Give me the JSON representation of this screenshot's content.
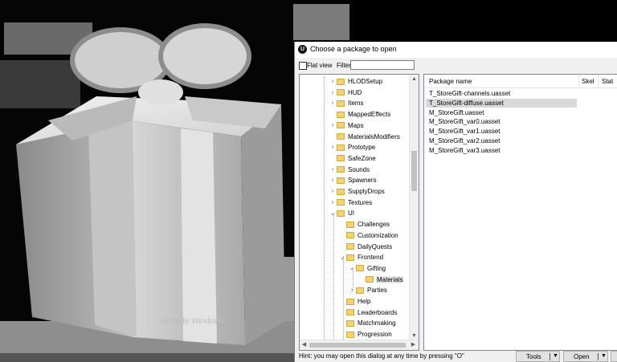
{
  "dialog": {
    "title": "Choose a package to open",
    "flat_view_label": "Flat view",
    "filter_label": "Filter:",
    "filter_value": ""
  },
  "tree": {
    "items": [
      {
        "label": "HLODSetup",
        "level": 0,
        "expandable": true,
        "expanded": false
      },
      {
        "label": "HUD",
        "level": 0,
        "expandable": true,
        "expanded": false
      },
      {
        "label": "Items",
        "level": 0,
        "expandable": true,
        "expanded": false
      },
      {
        "label": "MappedEffects",
        "level": 0,
        "expandable": false,
        "expanded": false
      },
      {
        "label": "Maps",
        "level": 0,
        "expandable": true,
        "expanded": false
      },
      {
        "label": "MaterialsModifiers",
        "level": 0,
        "expandable": false,
        "expanded": false
      },
      {
        "label": "Prototype",
        "level": 0,
        "expandable": true,
        "expanded": false
      },
      {
        "label": "SafeZone",
        "level": 0,
        "expandable": false,
        "expanded": false
      },
      {
        "label": "Sounds",
        "level": 0,
        "expandable": true,
        "expanded": false
      },
      {
        "label": "Spawners",
        "level": 0,
        "expandable": true,
        "expanded": false
      },
      {
        "label": "SupplyDrops",
        "level": 0,
        "expandable": true,
        "expanded": false
      },
      {
        "label": "Textures",
        "level": 0,
        "expandable": true,
        "expanded": false
      },
      {
        "label": "UI",
        "level": 0,
        "expandable": true,
        "expanded": true
      },
      {
        "label": "Challenges",
        "level": 1,
        "expandable": false,
        "expanded": false
      },
      {
        "label": "Customization",
        "level": 1,
        "expandable": false,
        "expanded": false
      },
      {
        "label": "DailyQuests",
        "level": 1,
        "expandable": false,
        "expanded": false
      },
      {
        "label": "Frontend",
        "level": 1,
        "expandable": true,
        "expanded": true
      },
      {
        "label": "Gifting",
        "level": 2,
        "expandable": true,
        "expanded": true
      },
      {
        "label": "Materials",
        "level": 3,
        "expandable": false,
        "expanded": false,
        "selected": true
      },
      {
        "label": "Parties",
        "level": 2,
        "expandable": true,
        "expanded": false
      },
      {
        "label": "Help",
        "level": 1,
        "expandable": false,
        "expanded": false
      },
      {
        "label": "Leaderboards",
        "level": 1,
        "expandable": false,
        "expanded": false
      },
      {
        "label": "Matchmaking",
        "level": 1,
        "expandable": false,
        "expanded": false
      },
      {
        "label": "Progression",
        "level": 1,
        "expandable": false,
        "expanded": false
      }
    ]
  },
  "list": {
    "columns": [
      "Package name",
      "Skel",
      "Stat"
    ],
    "rows": [
      {
        "name": "T_StoreGift-channels.uasset",
        "selected": false
      },
      {
        "name": "T_StoreGift-diffuse.uasset",
        "selected": true
      },
      {
        "name": "M_StoreGift.uasset",
        "selected": false
      },
      {
        "name": "M_StoreGift_var0.uasset",
        "selected": false
      },
      {
        "name": "M_StoreGift_var1.uasset",
        "selected": false
      },
      {
        "name": "M_StoreGift_var2.uasset",
        "selected": false
      },
      {
        "name": "M_StoreGift_var3.uasset",
        "selected": false
      }
    ]
  },
  "statusbar": {
    "hint": "Hint: you may open this dialog at any time by pressing \"O\"",
    "tools_label": "Tools",
    "open_label": "Open"
  },
  "watermark": "Activate Windows"
}
